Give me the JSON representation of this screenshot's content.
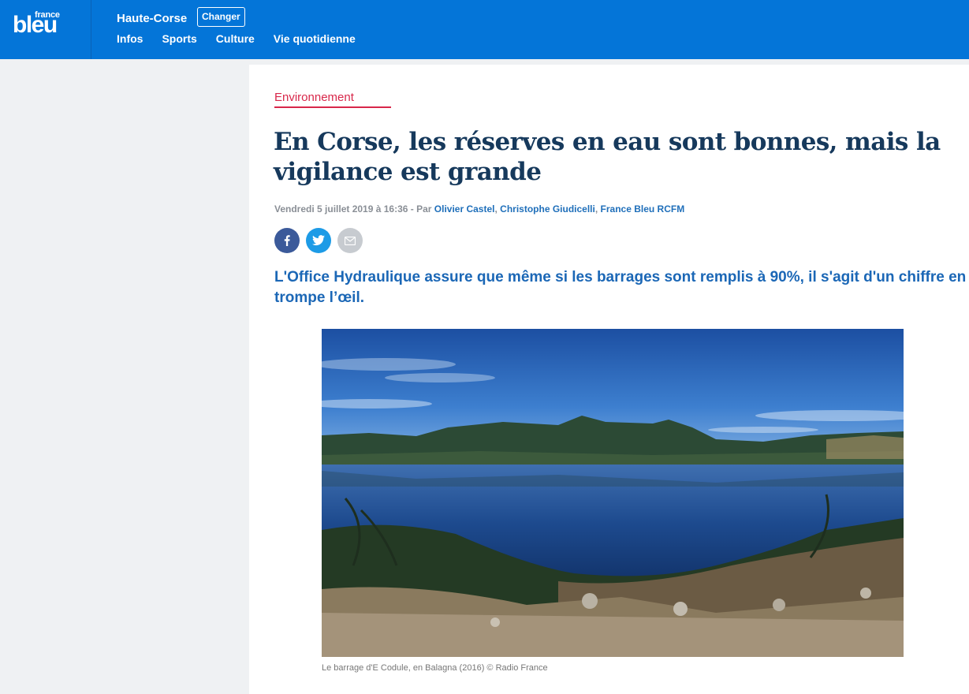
{
  "header": {
    "logo_small": "france",
    "logo_big": "bleu",
    "region": "Haute-Corse",
    "change_label": "Changer",
    "nav": [
      "Infos",
      "Sports",
      "Culture",
      "Vie quotidienne"
    ]
  },
  "article": {
    "category": "Environnement",
    "title": "En Corse, les réserves en eau sont bonnes, mais la vigilance est grande",
    "date": "Vendredi 5 juillet 2019 à 16:36 - Par ",
    "authors": [
      "Olivier Castel",
      "Christophe Giudicelli",
      "France Bleu RCFM"
    ],
    "author_separator": ", ",
    "chapo": "L'Office Hydraulique assure que même si les barrages sont remplis à 90%, il s'agit d'un chiffre en trompe l’œil.",
    "image_caption": "Le barrage d'E Codule, en Balagna (2016) © Radio France"
  },
  "share_icons": [
    "facebook-icon",
    "twitter-icon",
    "mail-icon"
  ],
  "colors": {
    "header_bg": "#0475d8",
    "category": "#d8274a",
    "title": "#16395c",
    "link": "#1f6fba",
    "chapo": "#1b67b6"
  }
}
